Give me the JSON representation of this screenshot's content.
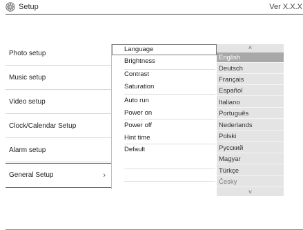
{
  "titlebar": {
    "title": "Setup",
    "version": "Ver X.X.X",
    "icon": "gear-icon"
  },
  "left_menu": {
    "items": [
      {
        "label": "Photo setup"
      },
      {
        "label": "Music setup"
      },
      {
        "label": "Video setup"
      },
      {
        "label": "Clock/Calendar Setup"
      },
      {
        "label": "Alarm setup"
      },
      {
        "label": "General Setup",
        "active": true,
        "chevron": "›"
      }
    ]
  },
  "general_options": {
    "items": [
      {
        "label": "Language",
        "selected": true
      },
      {
        "label": "Brightness"
      },
      {
        "label": "Contrast"
      },
      {
        "label": "Saturation"
      },
      {
        "label": "Auto run"
      },
      {
        "label": "Power on"
      },
      {
        "label": "Power off"
      },
      {
        "label": "Hint time"
      },
      {
        "label": "Default"
      }
    ]
  },
  "languages": {
    "scroll_up": "˄",
    "scroll_down": "˅",
    "items": [
      {
        "label": "English",
        "selected": true
      },
      {
        "label": "Deutsch"
      },
      {
        "label": "Français"
      },
      {
        "label": "Español"
      },
      {
        "label": "Italiano"
      },
      {
        "label": "Português"
      },
      {
        "label": "Nederlands"
      },
      {
        "label": "Polski"
      },
      {
        "label": "Русский"
      },
      {
        "label": "Magyar"
      },
      {
        "label": "Türkçe"
      },
      {
        "label": "Česky",
        "dim": true
      }
    ]
  }
}
